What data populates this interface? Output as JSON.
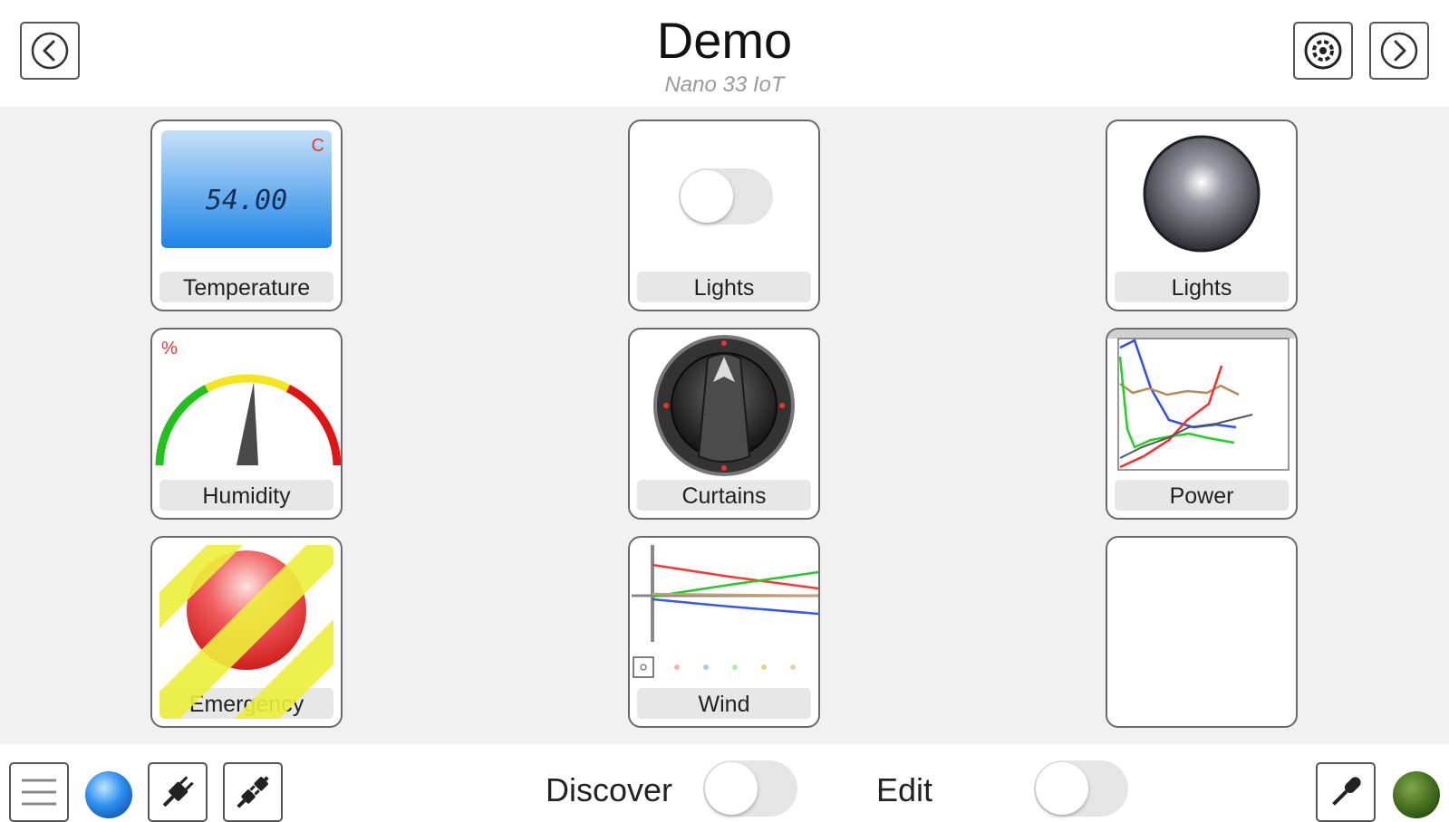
{
  "header": {
    "title": "Demo",
    "subtitle": "Nano 33 IoT",
    "icons": {
      "back": "chevron-left-icon",
      "settings": "circled-gear-icon",
      "forward": "chevron-right-icon"
    }
  },
  "tiles": [
    {
      "label": "Temperature",
      "type": "lcd-display",
      "value": "54.00",
      "unit": "C"
    },
    {
      "label": "Lights",
      "type": "switch",
      "state": "off"
    },
    {
      "label": "Lights",
      "type": "led-indicator",
      "state": "off"
    },
    {
      "label": "Humidity",
      "type": "gauge",
      "unit": "%"
    },
    {
      "label": "Curtains",
      "type": "rotary-knob"
    },
    {
      "label": "Power",
      "type": "line-plot"
    },
    {
      "label": "Emergency",
      "type": "push-button",
      "state": "disabled"
    },
    {
      "label": "Wind",
      "type": "line-plot"
    },
    {
      "label": "",
      "type": "empty"
    }
  ],
  "footer": {
    "discover_label": "Discover",
    "discover_state": "off",
    "edit_label": "Edit",
    "edit_state": "off",
    "icons": {
      "menu": "hamburger-menu-icon",
      "status": "blue-status-led-icon",
      "connect": "plug-icon",
      "disconnect": "unplug-icon",
      "voice": "microphone-icon",
      "connection": "green-status-led-icon"
    }
  },
  "colors": {
    "content_background": "#f1f1f1",
    "lcd_gradient_top": "#c6e1f7",
    "lcd_gradient_bottom": "#1c84e8",
    "emergency_stripe": "#ecf03a",
    "emergency_button": "#f04545",
    "status_led_blue": "#1677e6",
    "status_led_green": "#3f6a1a"
  }
}
